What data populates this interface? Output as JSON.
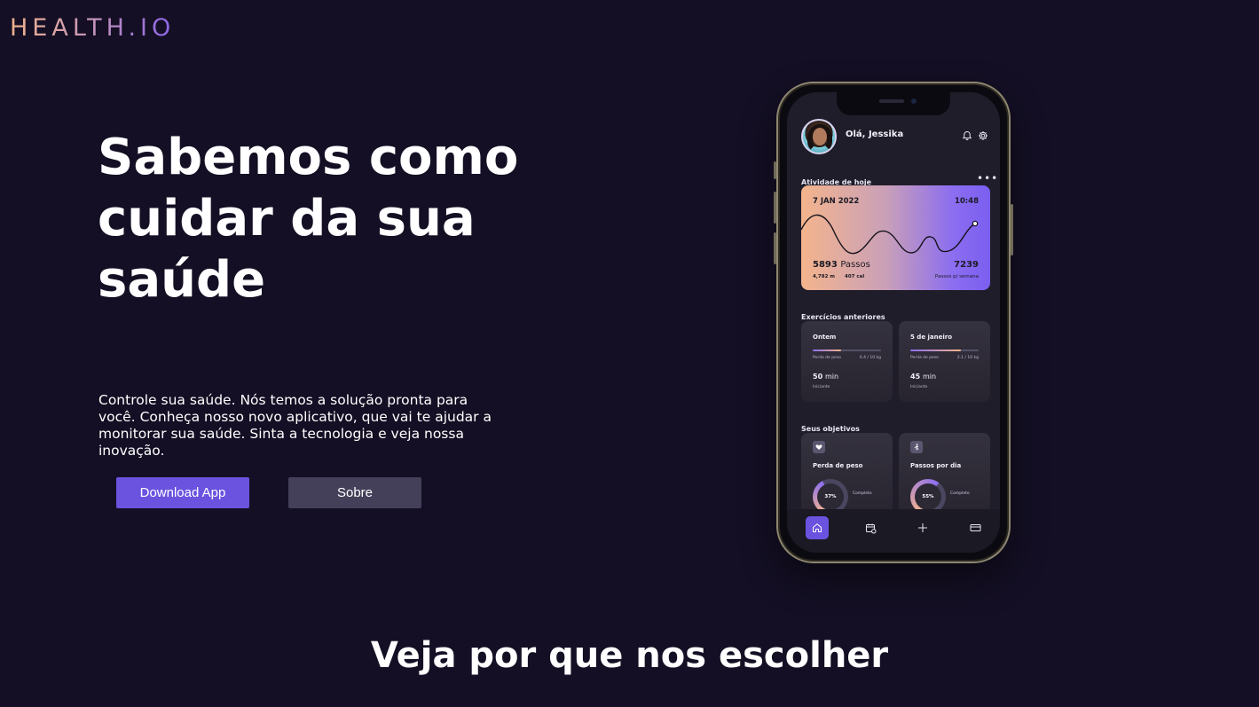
{
  "brand": {
    "logo": "HEALTH.IO"
  },
  "hero": {
    "title": "Sabemos como cuidar da sua saúde",
    "text": "Controle sua saúde. Nós temos a solução pronta para você. Conheça nosso novo aplicativo, que vai te ajudar a monitorar sua saúde. Sinta a tecnologia e veja nossa inovação.",
    "download_label": "Download App",
    "about_label": "Sobre"
  },
  "section": {
    "title": "Veja por que nos escolher"
  },
  "app": {
    "greeting": "Olá, Jessika",
    "icons": {
      "notifications": "bell-icon",
      "settings": "gear-icon",
      "more": "more-icon"
    },
    "today_label": "Atividade de hoje",
    "activity": {
      "date": "7 JAN 2022",
      "time": "10:48",
      "steps_value": "5893",
      "steps_unit": "Passos",
      "distance": "4,782 m",
      "calories": "407 cal",
      "week_steps": "7239",
      "week_label": "Passos p/ semana"
    },
    "previous_label": "Exercícios anteriores",
    "previous": [
      {
        "title": "Ontem",
        "sub": "Perda de peso",
        "sub_value": "6.4 / 10 kg",
        "progress": 0.42,
        "minutes": "50",
        "unit": "min",
        "level": "Iniciante"
      },
      {
        "title": "5 de janeiro",
        "sub": "Perda de peso",
        "sub_value": "2.1 / 10 kg",
        "progress": 0.74,
        "minutes": "45",
        "unit": "min",
        "level": "Iniciante"
      }
    ],
    "goals_label": "Seus objetivos",
    "goals": [
      {
        "title": "Perda de peso",
        "icon": "heart-icon",
        "percent": "37%",
        "progress": 0.37,
        "status": "Completo"
      },
      {
        "title": "Passos por dia",
        "icon": "walk-icon",
        "percent": "55%",
        "progress": 0.55,
        "status": "Completo"
      }
    ],
    "tabs": [
      "home-icon",
      "calendar-icon",
      "plus-icon",
      "card-icon"
    ],
    "colors": {
      "accent": "#6b53e0",
      "card_start": "#f4b48c",
      "card_end": "#7a5ef0"
    }
  }
}
